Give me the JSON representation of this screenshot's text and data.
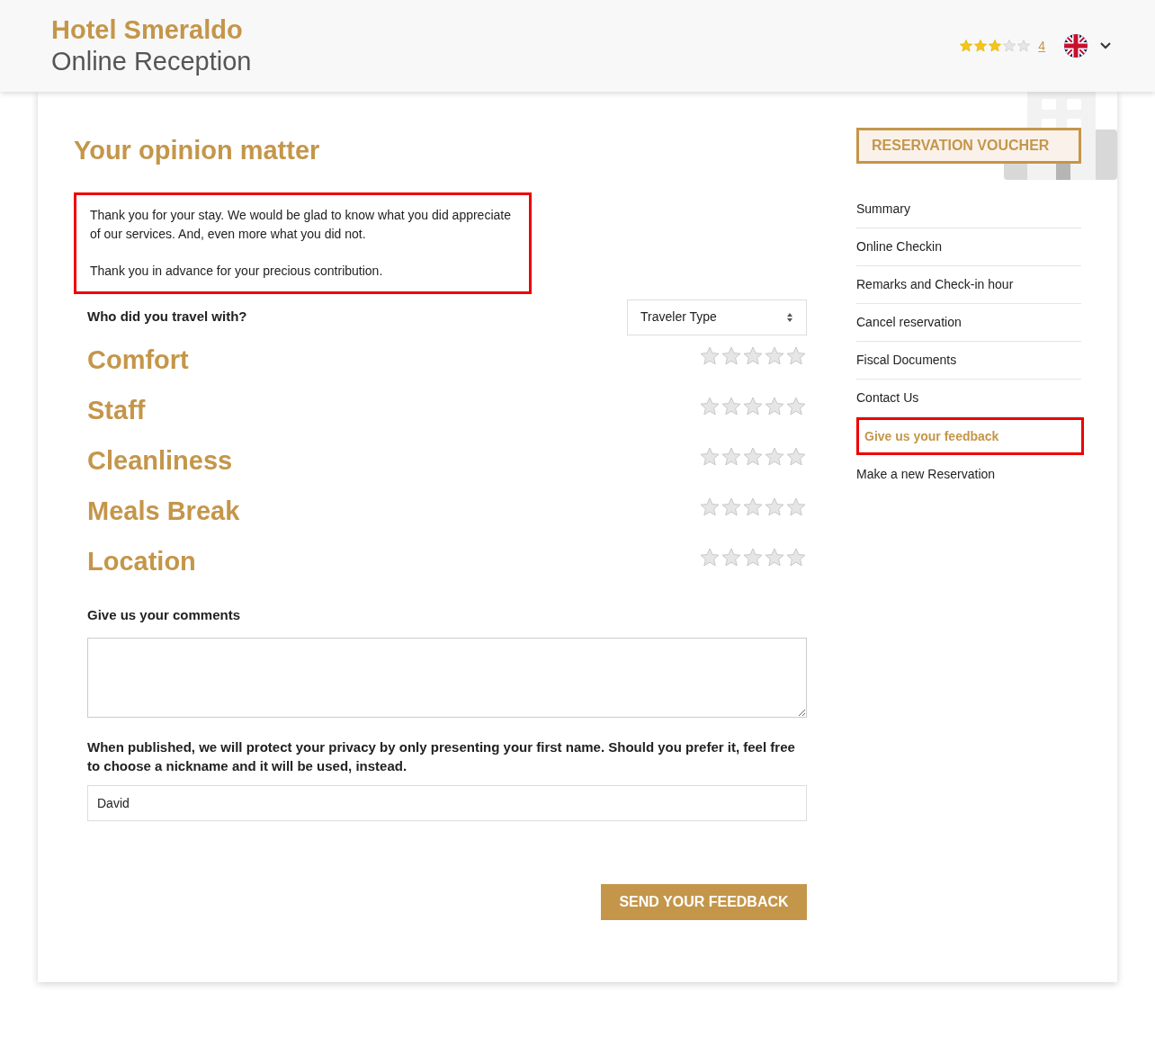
{
  "header": {
    "hotel_name": "Hotel Smeraldo",
    "subtitle": "Online Reception",
    "hotel_rating": {
      "stars": 3,
      "link": "4"
    }
  },
  "page_title": "Your opinion matter",
  "intro": {
    "paragraphs": [
      "Thank you for your stay. We would be glad to know what you did appreciate of our services. And, even more what you did not.",
      "Thank you in advance for your precious contribution."
    ]
  },
  "travel_with": {
    "label": "Who did you travel with?",
    "select": {
      "value": "Traveler Type"
    }
  },
  "ratings": [
    {
      "label": "Comfort",
      "stars": 0
    },
    {
      "label": "Staff",
      "stars": 0
    },
    {
      "label": "Cleanliness",
      "stars": 0
    },
    {
      "label": "Meals Break",
      "stars": 0
    },
    {
      "label": "Location",
      "stars": 0
    }
  ],
  "comments": {
    "label": "Give us your comments"
  },
  "nickname": {
    "label": "When published, we will protect your privacy by only presenting your first name. Should you prefer it, feel free to choose a nickname and it will be used, instead.",
    "value": "David"
  },
  "submit_button": "SEND YOUR FEEDBACK",
  "voucher_button": "RESERVATION VOUCHER",
  "sidebar": {
    "items": [
      {
        "label": "Summary",
        "selected": false
      },
      {
        "label": "Online Checkin",
        "selected": false
      },
      {
        "label": "Remarks and Check-in hour",
        "selected": false
      },
      {
        "label": "Cancel reservation",
        "selected": false
      },
      {
        "label": "Fiscal Documents",
        "selected": false
      },
      {
        "label": "Contact Us",
        "selected": false
      },
      {
        "label": "Give us your feedback",
        "selected": true
      },
      {
        "label": "Make a new Reservation",
        "selected": false
      }
    ]
  }
}
